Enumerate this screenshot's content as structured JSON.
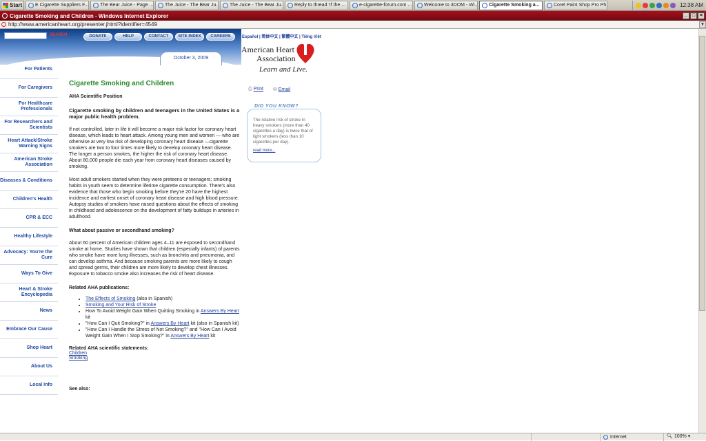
{
  "taskbar": {
    "start": "Start",
    "buttons": [
      {
        "label": "E Cigarette Suppliers F...",
        "active": false
      },
      {
        "label": "The Bear Juice - Page ...",
        "active": false
      },
      {
        "label": "The Juice - The Bear Ju...",
        "active": false
      },
      {
        "label": "The Juice - The Bear Ju...",
        "active": false
      },
      {
        "label": "Reply to thread 'If the ...",
        "active": false
      },
      {
        "label": "e-cigarette-forum.com ...",
        "active": false
      },
      {
        "label": "Welcome to 3DOM - Wi...",
        "active": false
      },
      {
        "label": "Cigarette Smoking a...",
        "active": true
      },
      {
        "label": "Corel Paint Shop Pro Ph...",
        "active": false
      }
    ],
    "clock": "12:38 AM"
  },
  "window": {
    "title": "Cigarette Smoking and Children - Windows Internet Explorer",
    "url": "http://www.americanheart.org/presenter.jhtml?identifier=4549"
  },
  "header": {
    "search_label": "SEARCH",
    "nav": [
      "DONATE",
      "HELP",
      "CONTACT",
      "SITE INDEX",
      "CAREERS"
    ],
    "date": "October 3, 2009",
    "langs": "Español | 简体中文 | 繁體中文 | Tiếng Việt",
    "logo_line1": "American Heart",
    "logo_line2": "Association",
    "tagline": "Learn and Live."
  },
  "sidebar": [
    "For Patients",
    "For Caregivers",
    "For Healthcare Professionals",
    "For Researchers and Scientists",
    "Heart Attack/Stroke Warning Signs",
    "American Stroke Association",
    "Diseases & Conditions",
    "Children's Health",
    "CPR & ECC",
    "Healthy Lifestyle",
    "Advocacy: You're the Cure",
    "Ways To Give",
    "Heart & Stroke Encyclopedia",
    "News",
    "Embrace Our Cause",
    "Shop Heart",
    "About Us",
    "Local Info"
  ],
  "article": {
    "title": "Cigarette Smoking and Children",
    "subtitle": "AHA Scientific Position",
    "intro": "Cigarette smoking by children and teenagers in the United States is a major public health problem.",
    "p1": "If not controlled, later in life it will become a major risk factor for coronary heart disease, which leads to heart attack. Among young men and women — who are otherwise at very low risk of developing coronary heart disease —cigarette smokers are two to four times more likely to develop coronary heart disease. The longer a person smokes, the higher the risk of coronary heart disease. About 80,000 people die each year from coronary heart diseases caused by smoking.",
    "p2": "Most adult smokers started when they were preteens or teenagers; smoking habits in youth seem to determine lifetime cigarette consumption. There's also evidence that those who begin smoking before they're 20 have the highest incidence and earliest onset of coronary heart disease and high blood pressure. Autopsy studies of smokers have raised questions about the effects of smoking in childhood and adolescence on the development of fatty buildups in arteries in adulthood.",
    "h_passive": "What about passive or secondhand smoking?",
    "p3": "About 60 percent of American children ages 4–11 are exposed to secondhand smoke at home. Studies have shown that children (especially infants) of parents who smoke have more lung illnesses, such as bronchitis and pneumonia, and can develop asthma. And because smoking parents are more likely to cough and spread germs, their children are more likely to develop chest illnesses. Exposure to tobacco smoke also increases the risk of heart disease.",
    "h_pubs": "Related AHA publications:",
    "pubs": {
      "l1_link": "The Effects of Smoking",
      "l1_rest": " (also in Spanish)",
      "l2_link": "Smoking and Your Risk of Stroke",
      "l3_pre": "How To Avoid Weight Gain When Quitting Smoking in ",
      "l3_link": "Answers By Heart",
      "l3_post": " kit",
      "l4_pre": "\"How Can I Quit Smoking?\" in ",
      "l4_link": "Answers By Heart",
      "l4_post": " kit (also in Spanish kit)",
      "l5_pre": "\"How Can I Handle the Stress of Not Smoking?\" and \"How Can I Avoid Weight Gain When I Stop Smoking?\" in ",
      "l5_link": "Answers By Heart",
      "l5_post": " kit"
    },
    "h_statements": "Related AHA scientific statements:",
    "statements": [
      "Children",
      "Smoking"
    ],
    "see_also": "See also:"
  },
  "tools": {
    "print": "Print",
    "email": "Email"
  },
  "dyk": {
    "heading": "DID YOU KNOW?",
    "text": "The relative risk of stroke in heavy smokers (more than 40 cigarettes a day) is twice that of light smokers (less than 10 cigarettes per day).",
    "link": "read more..."
  },
  "status": {
    "zone": "Internet",
    "zoom": "100%"
  }
}
